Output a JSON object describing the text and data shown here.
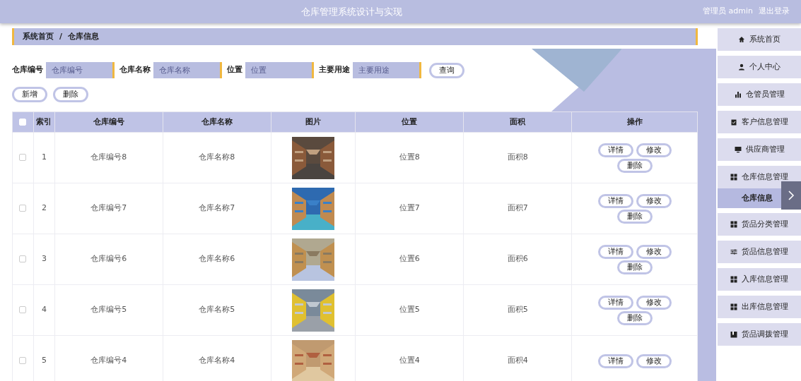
{
  "header": {
    "title": "仓库管理系统设计与实现",
    "user": "管理员 admin",
    "logout": "退出登录"
  },
  "breadcrumb": {
    "items": [
      "系统首页",
      "仓库信息"
    ],
    "separator": "/"
  },
  "search": {
    "fields": [
      {
        "label": "仓库编号",
        "placeholder": "仓库编号"
      },
      {
        "label": "仓库名称",
        "placeholder": "仓库名称"
      },
      {
        "label": "位置",
        "placeholder": "位置"
      },
      {
        "label": "主要用途",
        "placeholder": "主要用途"
      }
    ],
    "button": "查询"
  },
  "actions": [
    "新增",
    "删除"
  ],
  "table": {
    "select_all": {
      "checked": false
    },
    "columns": [
      "索引",
      "仓库编号",
      "仓库名称",
      "图片",
      "位置",
      "面积",
      "操作"
    ],
    "rows": [
      {
        "checked": false,
        "index": "1",
        "code": "仓库编号8",
        "name": "仓库名称8",
        "picture": {
          "kind": "picture"
        },
        "location": "位置8",
        "area": "面积8",
        "buttons": [
          "详情",
          "修改",
          "删除"
        ]
      },
      {
        "checked": false,
        "index": "2",
        "code": "仓库编号7",
        "name": "仓库名称7",
        "picture": {
          "kind": "picture"
        },
        "location": "位置7",
        "area": "面积7",
        "buttons": [
          "详情",
          "修改",
          "删除"
        ]
      },
      {
        "checked": false,
        "index": "3",
        "code": "仓库编号6",
        "name": "仓库名称6",
        "picture": {
          "kind": "picture"
        },
        "location": "位置6",
        "area": "面积6",
        "buttons": [
          "详情",
          "修改",
          "删除"
        ]
      },
      {
        "checked": false,
        "index": "4",
        "code": "仓库编号5",
        "name": "仓库名称5",
        "picture": {
          "kind": "picture"
        },
        "location": "位置5",
        "area": "面积5",
        "buttons": [
          "详情",
          "修改",
          "删除"
        ]
      },
      {
        "checked": false,
        "index": "5",
        "code": "仓库编号4",
        "name": "仓库名称4",
        "picture": {
          "kind": "picture"
        },
        "location": "位置4",
        "area": "面积4",
        "buttons": [
          "详情",
          "修改"
        ]
      }
    ]
  },
  "sidebar": {
    "items": [
      {
        "label": "系统首页",
        "selected": false
      },
      {
        "label": "个人中心",
        "selected": false
      },
      {
        "label": "仓管员管理",
        "selected": false
      },
      {
        "label": "客户信息管理",
        "selected": false
      },
      {
        "label": "供应商管理",
        "selected": false
      },
      {
        "label": "仓库信息管理",
        "selected": false,
        "children": [
          {
            "label": "仓库信息",
            "selected": true
          }
        ]
      },
      {
        "label": "货品分类管理",
        "selected": false
      },
      {
        "label": "货品信息管理",
        "selected": false
      },
      {
        "label": "入库信息管理",
        "selected": false
      },
      {
        "label": "出库信息管理",
        "selected": false
      },
      {
        "label": "货品调拨管理",
        "selected": false
      }
    ]
  }
}
